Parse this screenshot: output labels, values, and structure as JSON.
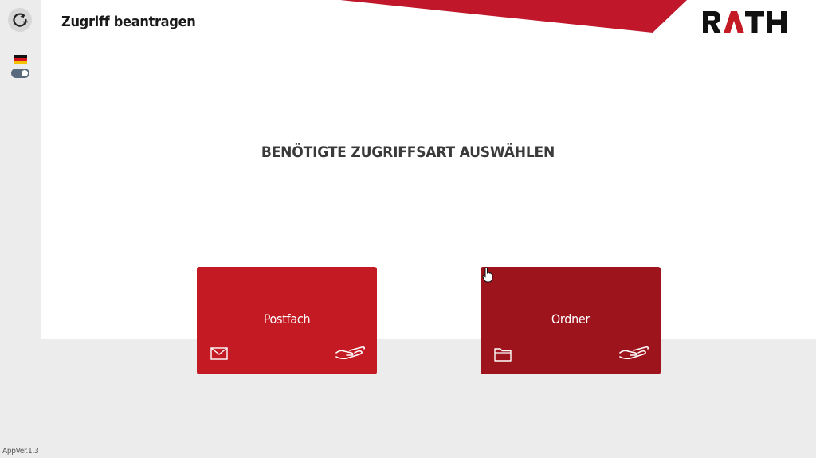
{
  "header": {
    "title": "Zugriff beantragen",
    "logo_text": "RATH"
  },
  "sidebar": {
    "app_icon": "refresh-plus-icon",
    "language_flag": "flag-germany-icon",
    "toggle_state": "on",
    "app_version": "AppVer.1.3"
  },
  "main": {
    "heading": "BENÖTIGTE ZUGRIFFSART AUSWÄHLEN",
    "options": [
      {
        "label": "Postfach",
        "icon": "mail-icon",
        "action_icon": "hand-icon"
      },
      {
        "label": "Ordner",
        "icon": "folder-icon",
        "action_icon": "hand-icon"
      }
    ]
  },
  "colors": {
    "brand_red": "#c41a24",
    "brand_red_dark": "#9e141d",
    "background_grey": "#ececec",
    "text_dark": "#1a1a1a"
  }
}
